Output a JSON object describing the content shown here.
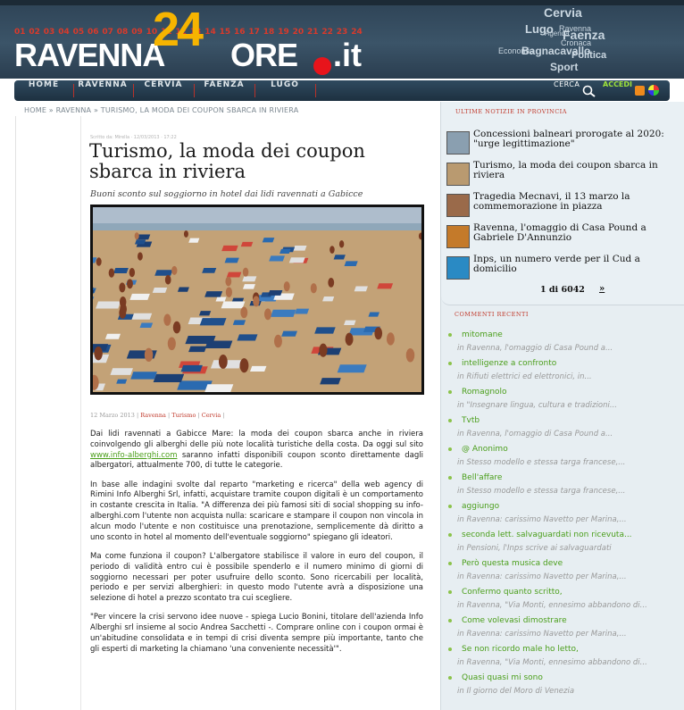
{
  "header": {
    "day_numbers": [
      "01",
      "02",
      "03",
      "04",
      "05",
      "06",
      "07",
      "08",
      "09",
      "10",
      "11",
      "12",
      "13",
      "14",
      "15",
      "16",
      "17",
      "18",
      "19",
      "20",
      "21",
      "22",
      "23",
      "24"
    ],
    "logo": {
      "part1": "RAVENNA",
      "part2": "24",
      "part3": "ORE",
      "part4": ".it"
    },
    "tag_cloud": [
      "Cervia",
      "Lugo",
      "Agenda",
      "Ravenna",
      "Faenza",
      "Cronaca",
      "Economia",
      "Bagnacavallo",
      "Politica",
      "Sport"
    ]
  },
  "nav": {
    "items": [
      "HOME",
      "RAVENNA",
      "CERVIA",
      "FAENZA",
      "LUGO"
    ],
    "search_label": "CERCA",
    "login_label": "ACCEDI"
  },
  "breadcrumb": "HOME » RAVENNA » TURISMO, LA MODA DEI COUPON SBARCA IN RIVIERA",
  "article": {
    "meta": "Scritto da: Mirella · 12/03/2013 · 17:22",
    "title": "Turismo, la moda dei coupon sbarca in riviera",
    "subtitle": "Buoni sconto sul soggiorno in hotel dai lidi ravennati a Gabicce",
    "date": "12 Marzo 2013",
    "categories": [
      "Ravenna",
      "Turismo",
      "Cervia"
    ],
    "p1_a": "Dai lidi ravennati a Gabicce Mare: la moda dei coupon sbarca anche in riviera coinvolgendo gli alberghi delle più note località turistiche della costa. Da oggi sul sito ",
    "p1_link": "www.info-alberghi.com",
    "p1_b": " saranno infatti disponibili coupon sconto direttamente dagli albergatori, attualmente 700, di tutte le categorie.",
    "p2": "In base alle indagini svolte dal reparto \"marketing e ricerca\" della web agency di Rimini Info Alberghi Srl, infatti, acquistare tramite coupon digitali è un comportamento in costante crescita in Italia. \"A differenza dei più famosi siti di social shopping su info-alberghi.com l'utente non acquista nulla: scaricare e stampare il coupon non vincola in alcun modo l'utente e non costituisce una prenotazione, semplicemente dà diritto a uno sconto in hotel al momento dell'eventuale soggiorno\" spiegano gli ideatori.",
    "p3": "Ma come funziona il coupon? L'albergatore stabilisce il valore in euro del coupon, il periodo di validità entro cui  è possibile spenderlo e il numero minimo di giorni di soggiorno necessari per poter usufruire dello sconto. Sono ricercabili per località, periodo e per servizi alberghieri: in questo modo l'utente avrà a disposizione una selezione di hotel a prezzo scontato tra cui scegliere.",
    "p4": "\"Per vincere la crisi servono idee nuove - spiega Lucio Bonini, titolare dell'azienda Info Alberghi srl insieme al socio Andrea Sacchetti -. Comprare online con i coupon ormai è un'abitudine consolidata e in tempi di crisi diventa sempre più importante, tanto che gli esperti di marketing la chiamano 'una conveniente necessità'\"."
  },
  "sidebar": {
    "news_heading": "ULTIME NOTIZIE IN PROVINCIA",
    "news": [
      {
        "title": "Concessioni balneari prorogate al 2020: \"urge legittimazione\"",
        "thumb_color": "#8a9fb0"
      },
      {
        "title": "Turismo, la moda dei coupon sbarca in riviera",
        "thumb_color": "#b99a70"
      },
      {
        "title": "Tragedia Mecnavi, il 13 marzo la commemorazione in piazza",
        "thumb_color": "#9a6a4a"
      },
      {
        "title": "Ravenna, l'omaggio di Casa Pound a Gabriele D'Annunzio",
        "thumb_color": "#c47a2a"
      },
      {
        "title": "Inps, un numero verde per il Cud a domicilio",
        "thumb_color": "#2a8ac4"
      }
    ],
    "pager": "1 di 6042",
    "pager_next": "»",
    "comments_heading": "COMMENTI RECENTI",
    "comments": [
      {
        "author": "mitomane",
        "post": "in  Ravenna, l'omaggio di Casa Pound a..."
      },
      {
        "author": "intelligenze a confronto",
        "post": "in  Rifiuti elettrici ed elettronici, in..."
      },
      {
        "author": "Romagnolo",
        "post": "in  \"Insegnare lingua, cultura e tradizioni..."
      },
      {
        "author": "Tvtb",
        "post": "in  Ravenna, l'omaggio di Casa Pound a..."
      },
      {
        "author": "@ Anonimo",
        "post": "in  Stesso modello e stessa targa francese,..."
      },
      {
        "author": "Bell'affare",
        "post": "in  Stesso modello e stessa targa francese,..."
      },
      {
        "author": "aggiungo",
        "post": "in  Ravenna: carissimo Navetto per Marina,..."
      },
      {
        "author": "seconda lett. salvaguardati non ricevuta...",
        "post": "in  Pensioni, l'Inps scrive ai salvaguardati"
      },
      {
        "author": "Però questa musica deve",
        "post": "in  Ravenna: carissimo Navetto per Marina,..."
      },
      {
        "author": "Confermo quanto scritto,",
        "post": "in  Ravenna, \"Via Monti, ennesimo abbandono di..."
      },
      {
        "author": "Come volevasi dimostrare",
        "post": "in  Ravenna: carissimo Navetto per Marina,..."
      },
      {
        "author": "Se non ricordo male ho letto,",
        "post": "in  Ravenna, \"Via Monti, ennesimo abbandono di..."
      },
      {
        "author": "Quasi quasi mi sono",
        "post": "in  Il giorno del Moro di Venezia"
      }
    ]
  }
}
